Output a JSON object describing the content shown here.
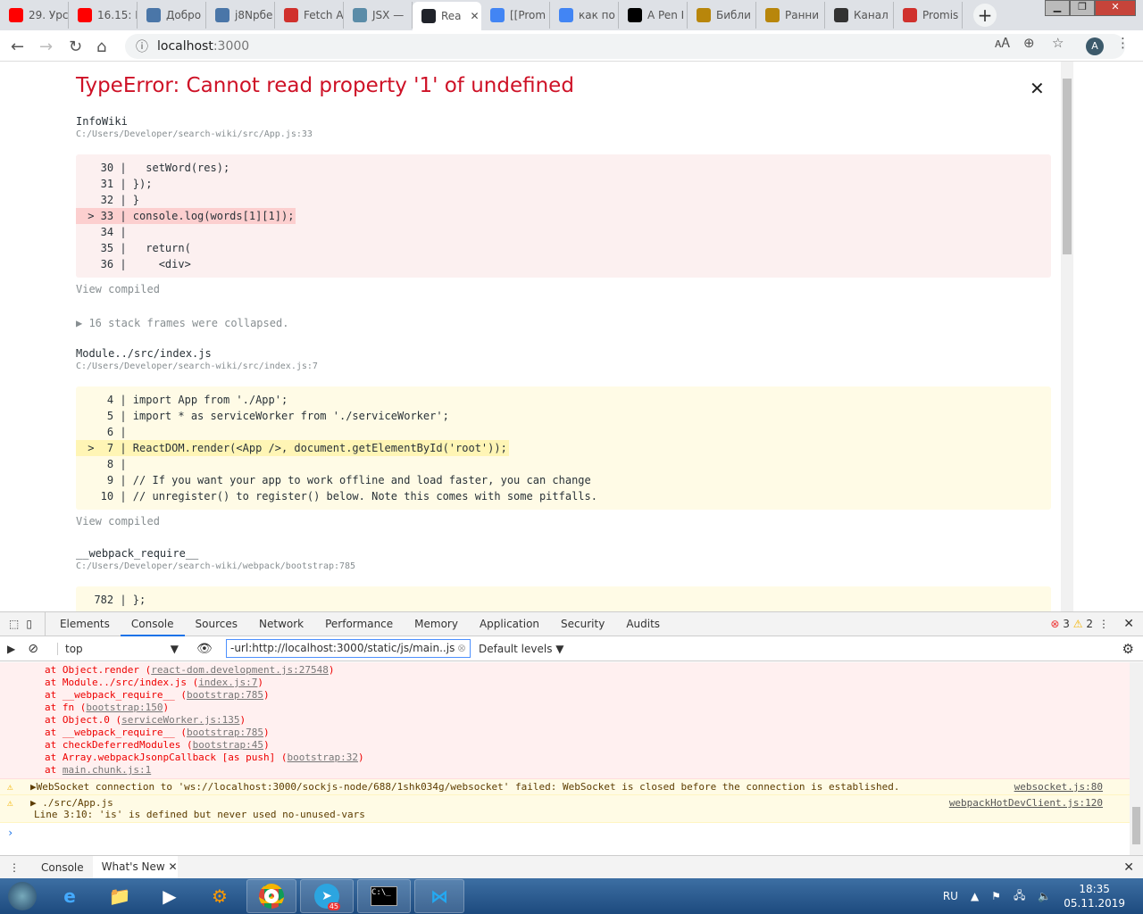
{
  "browser": {
    "tabs": [
      {
        "title": "29. Урс",
        "icon": "youtube-icon",
        "color": "#ff0000"
      },
      {
        "title": "16.15: I",
        "icon": "youtube-icon",
        "color": "#ff0000"
      },
      {
        "title": "Добро",
        "icon": "vk-icon",
        "color": "#4a76a8"
      },
      {
        "title": "j8Npбе",
        "icon": "vk-icon",
        "color": "#4a76a8"
      },
      {
        "title": "Fetch A",
        "icon": "tower-icon",
        "color": "#d0312d"
      },
      {
        "title": "JSX —",
        "icon": "h-icon",
        "color": "#5b8ca8"
      },
      {
        "title": "Rea",
        "icon": "react-icon",
        "color": "#20232a",
        "active": true
      },
      {
        "title": "[[Prom",
        "icon": "google-icon",
        "color": "#4285f4"
      },
      {
        "title": "как по",
        "icon": "google-icon",
        "color": "#4285f4"
      },
      {
        "title": "A Pen I",
        "icon": "codepen-icon",
        "color": "#000000"
      },
      {
        "title": "Библи",
        "icon": "glasses-icon",
        "color": "#b8860b"
      },
      {
        "title": "Ранни",
        "icon": "glasses-icon",
        "color": "#b8860b"
      },
      {
        "title": "Канал",
        "icon": "screen-icon",
        "color": "#333333"
      },
      {
        "title": "Promis",
        "icon": "tower-icon",
        "color": "#d0312d"
      }
    ],
    "url_host": "localhost",
    "url_port": ":3000",
    "profile": "A"
  },
  "overlay": {
    "title": "TypeError: Cannot read property '1' of undefined",
    "frames": [
      {
        "name": "InfoWiki",
        "path": "C:/Users/Developer/search-wiki/src/App.js:33",
        "kind": "red",
        "lines": [
          {
            "text": "   30 |   setWord(res);"
          },
          {
            "text": "   31 | });"
          },
          {
            "text": "   32 | }"
          },
          {
            "text": " > 33 | console.log(words[1][1]);",
            "hl": true
          },
          {
            "text": "   34 |"
          },
          {
            "text": "   35 |   return("
          },
          {
            "text": "   36 |     <div>"
          }
        ]
      },
      {
        "name": "Module../src/index.js",
        "path": "C:/Users/Developer/search-wiki/src/index.js:7",
        "kind": "yel",
        "lines": [
          {
            "text": "    4 | import App from './App';"
          },
          {
            "text": "    5 | import * as serviceWorker from './serviceWorker';"
          },
          {
            "text": "    6 |"
          },
          {
            "text": " >  7 | ReactDOM.render(<App />, document.getElementById('root'));",
            "hl": true
          },
          {
            "text": "    8 |"
          },
          {
            "text": "    9 | // If you want your app to work offline and load faster, you can change"
          },
          {
            "text": "   10 | // unregister() to register() below. Note this comes with some pitfalls."
          }
        ]
      },
      {
        "name": "__webpack_require__",
        "path": "C:/Users/Developer/search-wiki/webpack/bootstrap:785",
        "kind": "yel",
        "lines": [
          {
            "text": "  782 | };"
          }
        ]
      }
    ],
    "view_compiled": "View compiled",
    "collapsed": "▶ 16 stack frames were collapsed."
  },
  "devtools": {
    "tabs": [
      "Elements",
      "Console",
      "Sources",
      "Network",
      "Performance",
      "Memory",
      "Application",
      "Security",
      "Audits"
    ],
    "active_tab": "Console",
    "error_count": "3",
    "warning_count": "2",
    "context": "top",
    "filter": "-url:http://localhost:3000/static/js/main..js",
    "levels": "Default levels ▼",
    "stack": [
      {
        "pre": "at Object.render (",
        "link": "react-dom.development.js:27548",
        "post": ")"
      },
      {
        "pre": "at Module../src/index.js (",
        "link": "index.js:7",
        "post": ")"
      },
      {
        "pre": "at __webpack_require__ (",
        "link": "bootstrap:785",
        "post": ")"
      },
      {
        "pre": "at fn (",
        "link": "bootstrap:150",
        "post": ")"
      },
      {
        "pre": "at Object.0 (",
        "link": "serviceWorker.js:135",
        "post": ")"
      },
      {
        "pre": "at __webpack_require__ (",
        "link": "bootstrap:785",
        "post": ")"
      },
      {
        "pre": "at checkDeferredModules (",
        "link": "bootstrap:45",
        "post": ")"
      },
      {
        "pre": "at Array.webpackJsonpCallback [as push] (",
        "link": "bootstrap:32",
        "post": ")"
      },
      {
        "pre": "at ",
        "link": "main.chunk.js:1",
        "post": ""
      }
    ],
    "warnings": [
      {
        "text": "▶WebSocket connection to 'ws://localhost:3000/sockjs-node/688/1shk034g/websocket' failed: WebSocket is closed before the connection is established.",
        "source": "websocket.js:80"
      },
      {
        "text": "▶ ./src/App.js",
        "detail": "Line 3:10:  'is' is defined but never used  no-unused-vars",
        "source": "webpackHotDevClient.js:120"
      }
    ],
    "drawer_tabs": [
      "Console",
      "What's New"
    ]
  },
  "taskbar": {
    "lang": "RU",
    "time": "18:35",
    "date": "05.11.2019",
    "telegram_badge": "45"
  }
}
